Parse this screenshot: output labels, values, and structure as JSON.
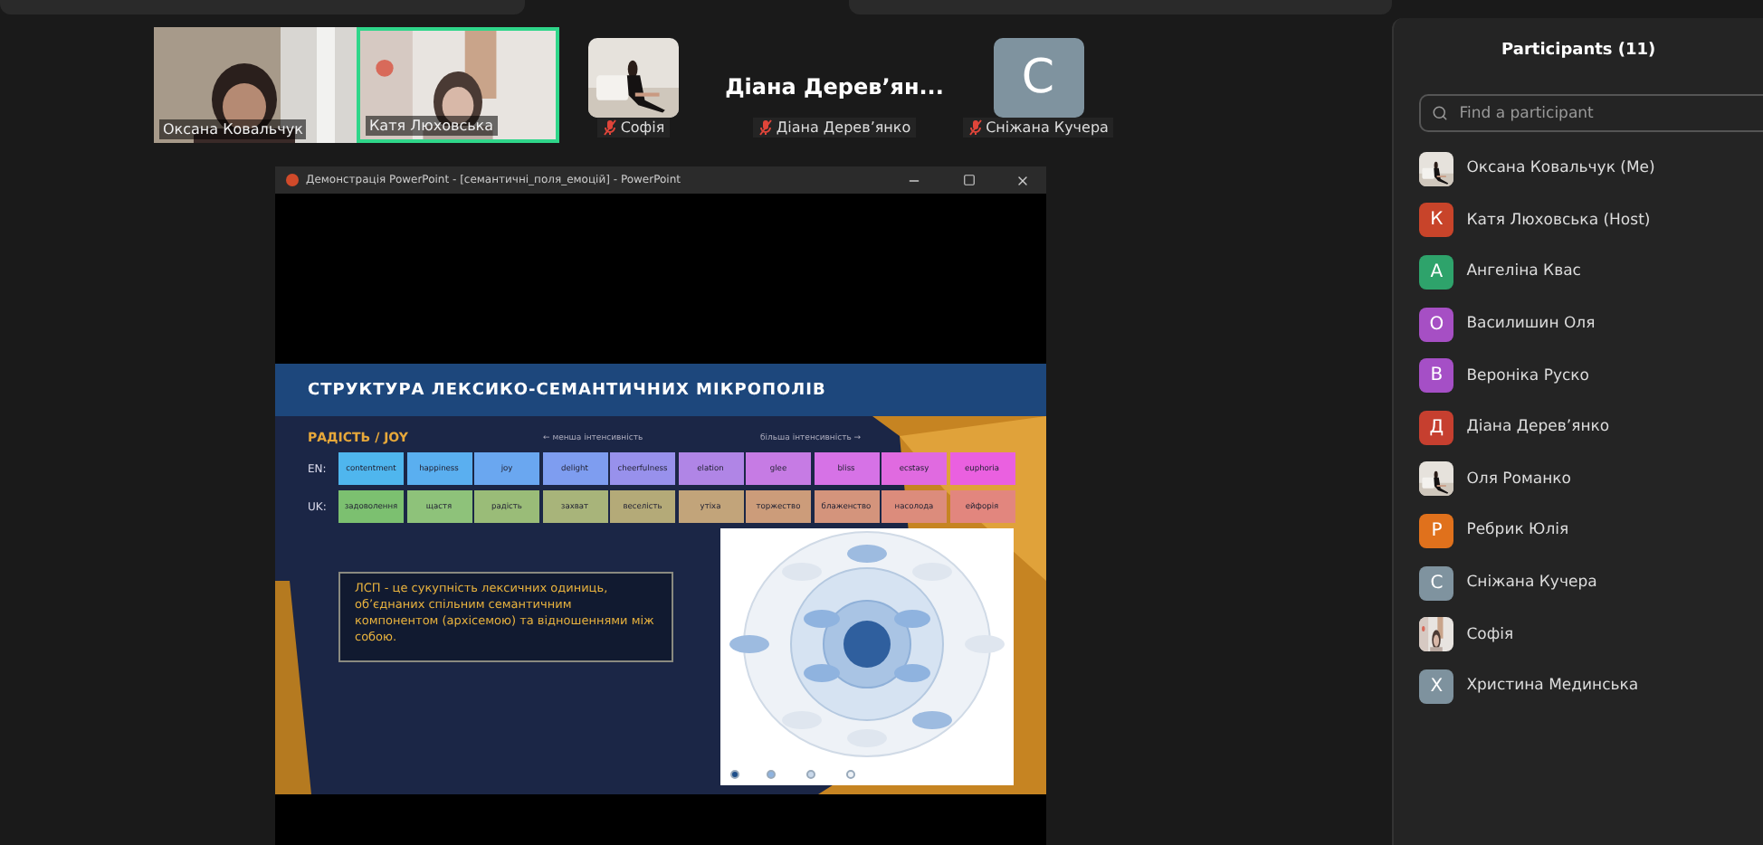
{
  "gallery": [
    {
      "kind": "video",
      "name": "Оксана Ковальчук",
      "speaking": false
    },
    {
      "kind": "video",
      "name": "Катя Люховська",
      "speaking": true
    },
    {
      "name": "Софія",
      "muted": true
    },
    {
      "kind": "name",
      "display": "Діана Дерев’ян...",
      "name": "Діана Дерев’янко",
      "muted": true
    },
    {
      "kind": "avatar",
      "initial": "С",
      "color": "#7f939f",
      "name": "Сніжана Кучера",
      "muted": true
    }
  ],
  "powerpoint": {
    "title": "Демонстрація PowerPoint - [семантичні_поля_емоцій] - PowerPoint",
    "slide": {
      "title": "СТРУКТУРА ЛЕКСИКО-СЕМАНТИЧНИХ МІКРОПОЛІВ",
      "section": "РАДІСТЬ / JOY",
      "less": "← менша інтенсивність",
      "more": "більша інтенсивність →",
      "rows": [
        {
          "label": "EN:",
          "cells": [
            {
              "text": "contentment",
              "color": "#4fb6ee"
            },
            {
              "text": "happiness",
              "color": "#5aaff0"
            },
            {
              "text": "joy",
              "color": "#6aa7f0"
            },
            {
              "text": "delight",
              "color": "#7e9df0"
            },
            {
              "text": "cheerfulness",
              "color": "#9891ec"
            },
            {
              "text": "elation",
              "color": "#b085e6"
            },
            {
              "text": "glee",
              "color": "#c67be4"
            },
            {
              "text": "bliss",
              "color": "#d672e6"
            },
            {
              "text": "ecstasy",
              "color": "#e06ae0"
            },
            {
              "text": "euphoria",
              "color": "#ea60e0"
            }
          ]
        },
        {
          "label": "UK:",
          "cells": [
            {
              "text": "задоволення",
              "color": "#7cc070"
            },
            {
              "text": "щастя",
              "color": "#8ec27a"
            },
            {
              "text": "радість",
              "color": "#9abc78"
            },
            {
              "text": "захват",
              "color": "#a8b47a"
            },
            {
              "text": "веселість",
              "color": "#b4aa78"
            },
            {
              "text": "утіха",
              "color": "#c2a47a"
            },
            {
              "text": "торжество",
              "color": "#cc9c7a"
            },
            {
              "text": "блаженство",
              "color": "#d4947c"
            },
            {
              "text": "насолода",
              "color": "#dc8c7c"
            },
            {
              "text": "ейфорія",
              "color": "#e2867e"
            }
          ]
        }
      ],
      "definition": "ЛСП - це сукупність лексичних одиниць, об’єднаних спільним семантичним компонентом (архісемою) та відношеннями між собою."
    }
  },
  "participants": {
    "title": "Participants (11)",
    "search": {
      "placeholder": "Find a participant"
    },
    "items": [
      {
        "name": "Оксана Ковальчук (Me)"
      },
      {
        "kind": "avatar",
        "initial": "К",
        "color": "#c8442a",
        "name": "Катя Люховська (Host)"
      },
      {
        "kind": "avatar",
        "initial": "А",
        "color": "#2ea36b",
        "name": "Ангеліна Квас"
      },
      {
        "kind": "avatar",
        "initial": "О",
        "color": "#a64fc4",
        "name": "Василишин Оля"
      },
      {
        "kind": "avatar",
        "initial": "В",
        "color": "#a54fc6",
        "name": "Вероніка Руско"
      },
      {
        "kind": "avatar",
        "initial": "Д",
        "color": "#c63f2f",
        "name": "Діана Дерев’янко"
      },
      {
        "name": "Оля Романко"
      },
      {
        "kind": "avatar",
        "initial": "Р",
        "color": "#e0711c",
        "name": "Ребрик Юлія"
      },
      {
        "kind": "avatar",
        "initial": "С",
        "color": "#7f939f",
        "name": "Сніжана Кучера"
      },
      {
        "name": "Софія"
      },
      {
        "kind": "avatar",
        "initial": "Х",
        "color": "#7e929e",
        "name": "Христина Мединська"
      }
    ]
  }
}
